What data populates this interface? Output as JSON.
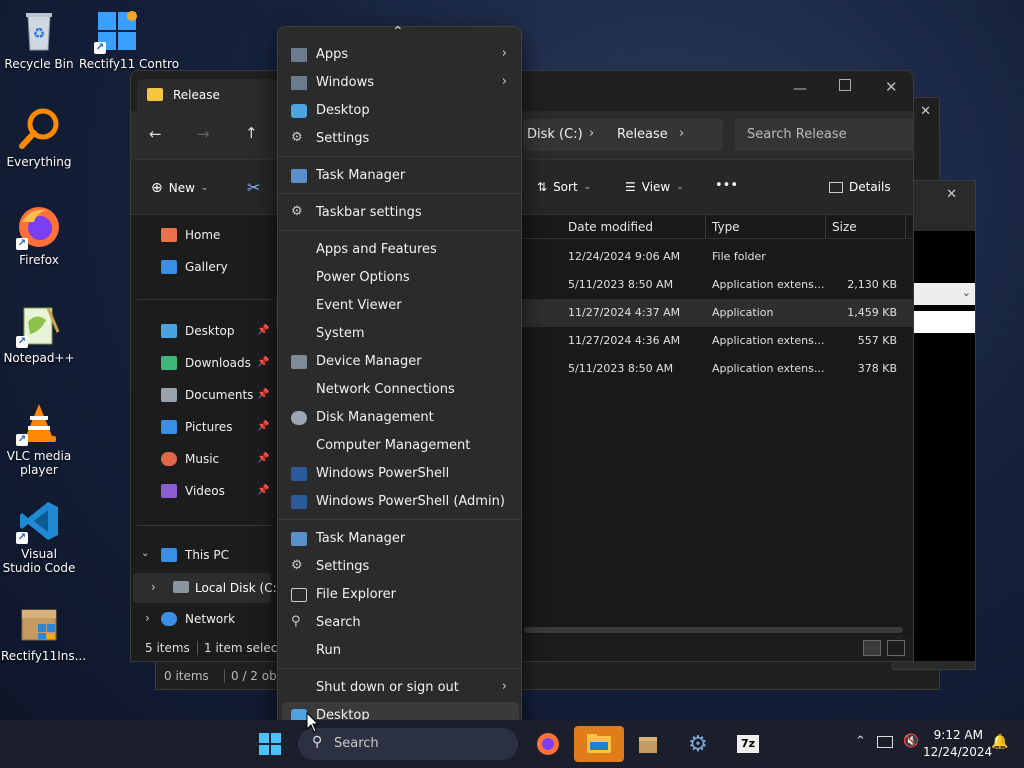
{
  "desktop_icons": [
    {
      "label": "Recycle Bin",
      "icon": "recycle-bin-icon"
    },
    {
      "label": "Rectify11 Contro",
      "icon": "control-panel-icon"
    },
    {
      "label": "Everything",
      "icon": "everything-search-icon"
    },
    {
      "label": "Firefox",
      "icon": "firefox-icon"
    },
    {
      "label": "Notepad++",
      "icon": "notepad-plus-plus-icon"
    },
    {
      "label": "VLC media player",
      "icon": "vlc-icon"
    },
    {
      "label": "Visual Studio Code",
      "icon": "vscode-icon"
    },
    {
      "label": "Rectify11Ins...",
      "icon": "installer-icon"
    }
  ],
  "explorer": {
    "tab_title": "Release",
    "breadcrumb": {
      "drive": "Disk (C:)",
      "folder": "Release"
    },
    "search_placeholder": "Search Release",
    "toolbar": {
      "new": "New",
      "sort": "Sort",
      "view": "View",
      "more": "•••",
      "details": "Details"
    },
    "sidebar": {
      "home": "Home",
      "gallery": "Gallery",
      "pinned": [
        "Desktop",
        "Downloads",
        "Documents",
        "Pictures",
        "Music",
        "Videos"
      ],
      "this_pc": "This PC",
      "local_disk": "Local Disk (C:)",
      "network": "Network"
    },
    "columns": {
      "date": "Date modified",
      "type": "Type",
      "size": "Size"
    },
    "rows": [
      {
        "date": "12/24/2024 9:06 AM",
        "type": "File folder",
        "size": ""
      },
      {
        "date": "5/11/2023 8:50 AM",
        "type": "Application extens...",
        "size": "2,130 KB"
      },
      {
        "date": "11/27/2024 4:37 AM",
        "type": "Application",
        "size": "1,459 KB"
      },
      {
        "date": "11/27/2024 4:36 AM",
        "type": "Application extens...",
        "size": "557 KB"
      },
      {
        "date": "5/11/2023 8:50 AM",
        "type": "Application extens...",
        "size": "378 KB"
      }
    ],
    "status": {
      "items": "5 items",
      "selected": "1 item selecte"
    }
  },
  "bg_window": {
    "items": "0 items",
    "objects": "0 / 2 objec"
  },
  "menu": {
    "items": [
      {
        "label": "Apps",
        "icon": "apps-icon",
        "sub": true
      },
      {
        "label": "Windows",
        "icon": "windows-icon",
        "sub": true
      },
      {
        "label": "Desktop",
        "icon": "desktop-icon"
      },
      {
        "label": "Settings",
        "icon": "settings-icon"
      },
      {
        "label": "Task Manager",
        "icon": "task-manager-icon"
      },
      {
        "label": "Taskbar settings",
        "icon": "gear-icon"
      },
      {
        "label": "Apps and Features"
      },
      {
        "label": "Power Options"
      },
      {
        "label": "Event Viewer"
      },
      {
        "label": "System"
      },
      {
        "label": "Device Manager",
        "icon": "device-manager-icon"
      },
      {
        "label": "Network Connections"
      },
      {
        "label": "Disk Management",
        "icon": "disk-management-icon"
      },
      {
        "label": "Computer Management"
      },
      {
        "label": "Windows PowerShell",
        "icon": "powershell-icon"
      },
      {
        "label": "Windows PowerShell (Admin)",
        "icon": "powershell-icon"
      },
      {
        "label": "Task Manager",
        "icon": "task-manager-icon"
      },
      {
        "label": "Settings",
        "icon": "gear-icon"
      },
      {
        "label": "File Explorer",
        "icon": "file-explorer-icon"
      },
      {
        "label": "Search",
        "icon": "search-icon"
      },
      {
        "label": "Run"
      },
      {
        "label": "Shut down or sign out",
        "sub": true
      },
      {
        "label": "Desktop",
        "icon": "desktop-icon",
        "highlighted": true
      }
    ]
  },
  "taskbar": {
    "search_label": "Search",
    "time": "9:12 AM",
    "date": "12/24/2024",
    "apps": [
      "firefox-icon",
      "file-explorer-icon",
      "archive-icon",
      "settings-icon",
      "7zip-icon"
    ]
  }
}
